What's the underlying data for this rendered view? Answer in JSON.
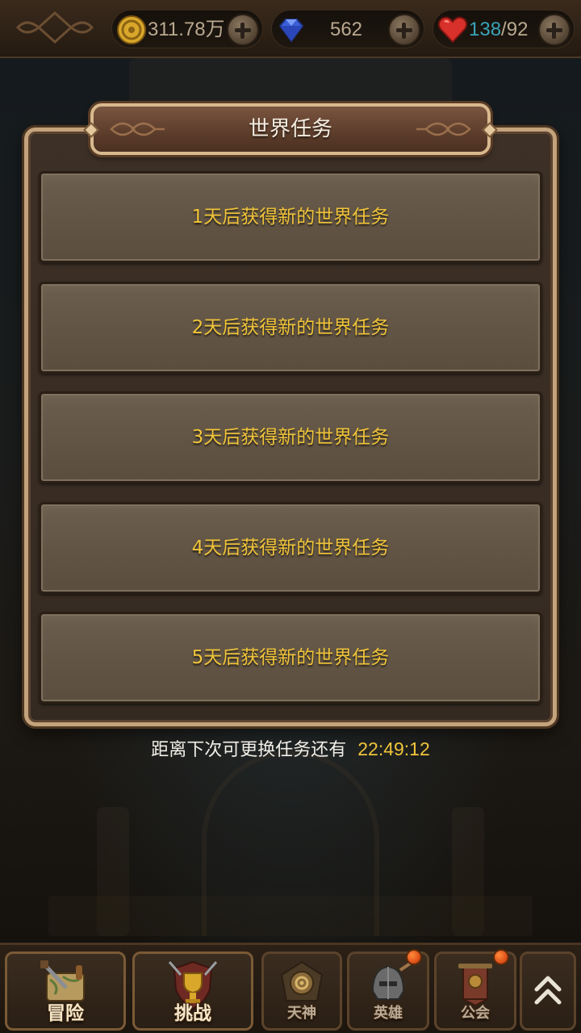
{
  "topbar": {
    "gold": {
      "icon": "gold-coin-icon",
      "value": "311.78万"
    },
    "gems": {
      "icon": "diamond-icon",
      "value": "562"
    },
    "stamina": {
      "icon": "heart-icon",
      "current": "138",
      "separator": "/",
      "max": "92"
    }
  },
  "panel": {
    "title": "世界任务",
    "tasks": [
      {
        "label": "1天后获得新的世界任务"
      },
      {
        "label": "2天后获得新的世界任务"
      },
      {
        "label": "3天后获得新的世界任务"
      },
      {
        "label": "4天后获得新的世界任务"
      },
      {
        "label": "5天后获得新的世界任务"
      }
    ]
  },
  "countdown": {
    "label": "距离下次可更换任务还有",
    "time": "22:49:12"
  },
  "bottom_nav": {
    "items": [
      {
        "label": "冒险",
        "icon": "map-scroll-sword-icon",
        "badge": false
      },
      {
        "label": "挑战",
        "icon": "trophy-shield-icon",
        "badge": false
      },
      {
        "label": "天神",
        "icon": "god-emblem-icon",
        "badge": false
      },
      {
        "label": "英雄",
        "icon": "hero-helmet-icon",
        "badge": true
      },
      {
        "label": "公会",
        "icon": "guild-banner-icon",
        "badge": true
      }
    ],
    "expand_icon": "double-chevron-up-icon"
  },
  "colors": {
    "task_text": "#f0c43a",
    "countdown_time": "#f0c43a",
    "stamina_current": "#38a3b8",
    "panel_border": "#c4a37c",
    "badge": "#e0521a"
  }
}
